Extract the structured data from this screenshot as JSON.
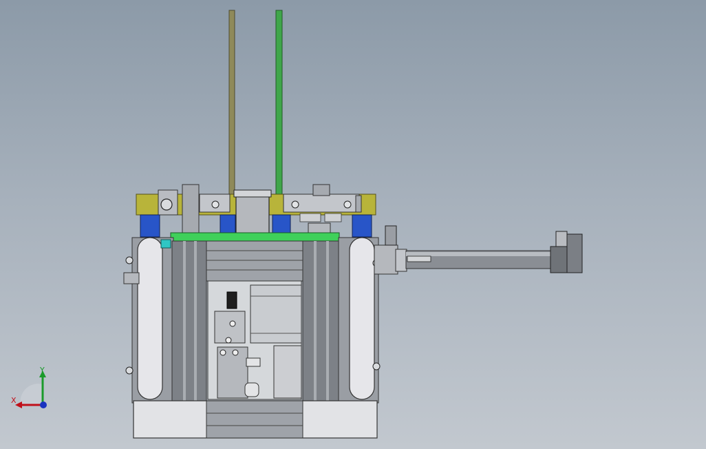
{
  "viewport": {
    "background_top": "#8c9aa8",
    "background_bottom": "#c2c8cf"
  },
  "model": {
    "name": "gripper-assembly-front-view",
    "label_plate_left": "",
    "label_plate_right": ""
  },
  "triad": {
    "x_label": "X",
    "y_label": "Y",
    "x_color": "#c0101a",
    "y_color": "#1a9a2a",
    "z_color": "#1a33c0"
  },
  "colors": {
    "steel": "#b9bcc1",
    "dark_steel": "#6f7378",
    "yellow_part": "#b8b43a",
    "blue_part": "#2855c8",
    "green_plate": "#3fd05a",
    "green_rod": "#3fa64a",
    "olive_rod": "#8f8a5a",
    "white_plate": "#e6e6ea",
    "cyan_part": "#2fc6c4"
  }
}
